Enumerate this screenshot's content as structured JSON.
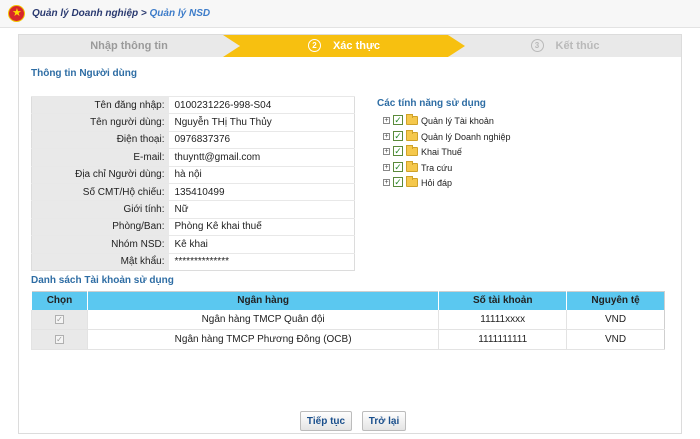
{
  "breadcrumb": {
    "parent": "Quản lý Doanh nghiệp",
    "separator": ">",
    "current": "Quản lý NSD"
  },
  "steps": [
    {
      "label": "Nhập thông tin",
      "number": "",
      "state": "done"
    },
    {
      "label": "Xác thực",
      "number": "2",
      "state": "active"
    },
    {
      "label": "Kết thúc",
      "number": "3",
      "state": "pending"
    }
  ],
  "user_info": {
    "title": "Thông tin Người dùng",
    "rows": [
      {
        "label": "Tên đăng nhập:",
        "value": "0100231226-998-S04"
      },
      {
        "label": "Tên người dùng:",
        "value": "Nguyễn THị Thu Thủy"
      },
      {
        "label": "Điện thoại:",
        "value": "0976837376"
      },
      {
        "label": "E-mail:",
        "value": "thuyntt@gmail.com"
      },
      {
        "label": "Địa chỉ Người dùng:",
        "value": "hà nội"
      },
      {
        "label": "Số CMT/Hộ chiếu:",
        "value": "135410499"
      },
      {
        "label": "Giới tính:",
        "value": "Nữ"
      },
      {
        "label": "Phòng/Ban:",
        "value": "Phòng Kê khai thuế"
      },
      {
        "label": "Nhóm NSD:",
        "value": "Kê khai"
      },
      {
        "label": "Mật khẩu:",
        "value": "**************"
      }
    ]
  },
  "features": {
    "title": "Các tính năng sử dụng",
    "items": [
      {
        "label": "Quản lý Tài khoản",
        "checked": true
      },
      {
        "label": "Quản lý Doanh nghiệp",
        "checked": true
      },
      {
        "label": "Khai Thuế",
        "checked": true
      },
      {
        "label": "Tra cứu",
        "checked": true
      },
      {
        "label": "Hỏi đáp",
        "checked": true
      }
    ],
    "expander_glyph": "+",
    "check_glyph": "✓"
  },
  "accounts": {
    "title": "Danh sách Tài khoản sử dụng",
    "columns": [
      "Chọn",
      "Ngân hàng",
      "Số tài khoản",
      "Nguyên tệ"
    ],
    "rows": [
      {
        "selected": true,
        "bank": "Ngân hàng TMCP Quân đội",
        "account_no": "11111xxxx",
        "currency": "VND"
      },
      {
        "selected": true,
        "bank": "Ngân hàng TMCP Phương Đông (OCB)",
        "account_no": "1111111111",
        "currency": "VND"
      }
    ],
    "check_glyph": "✓"
  },
  "buttons": {
    "continue": "Tiếp tục",
    "back": "Trở lại"
  },
  "colors": {
    "accent": "#2e6da4",
    "step_active": "#f7c010",
    "table_header": "#5bc8f0",
    "emblem": "#d7262b"
  }
}
